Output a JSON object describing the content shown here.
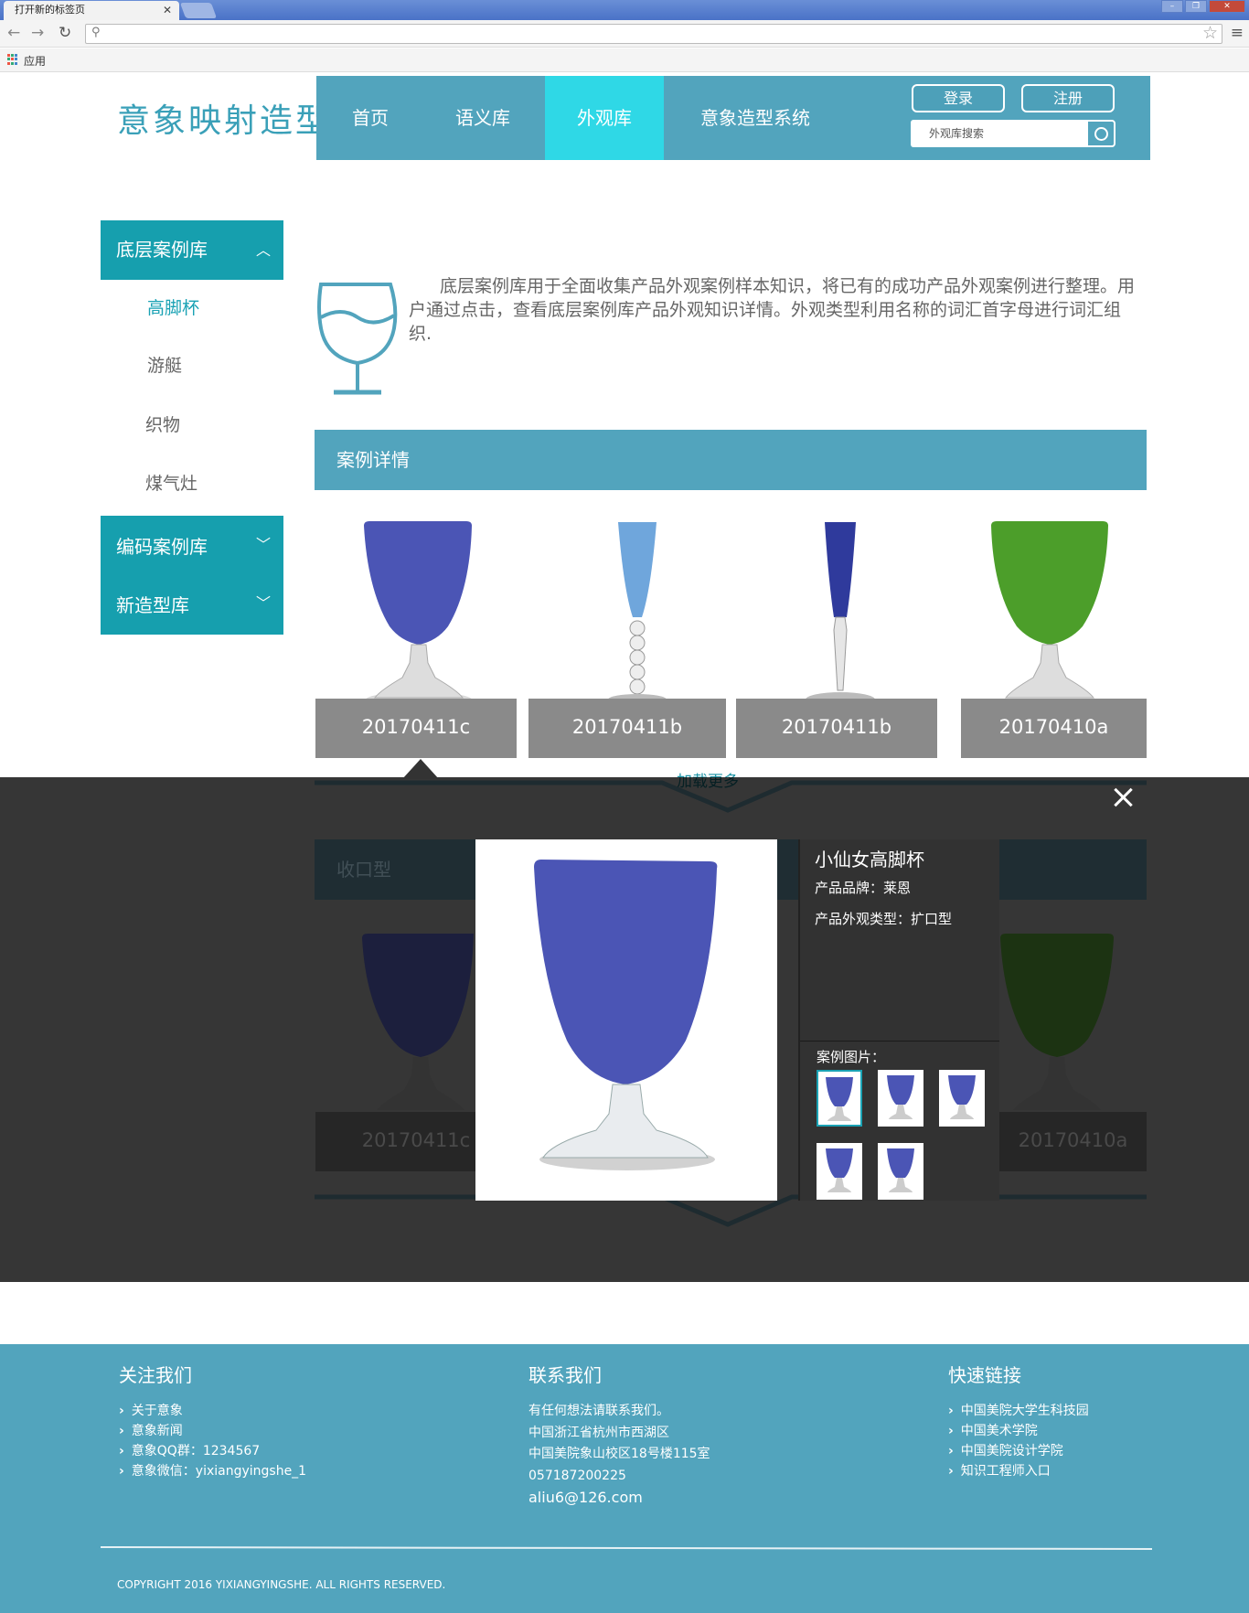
{
  "browser": {
    "tab_title": "打开新的标签页",
    "tab_close": "✕",
    "bookmark_apps": "应用"
  },
  "site": {
    "logo": "意象映射造型",
    "nav": [
      {
        "label": "首页"
      },
      {
        "label": "语义库"
      },
      {
        "label": "外观库"
      },
      {
        "label": "意象造型系统"
      }
    ],
    "login": "登录",
    "register": "注册",
    "search_placeholder": "外观库搜索"
  },
  "sidebar": {
    "group1": "底层案例库",
    "items": [
      "高脚杯",
      "游艇",
      "织物",
      "煤气灶"
    ],
    "group2": "编码案例库",
    "group3": "新造型库"
  },
  "intro": "底层案例库用于全面收集产品外观案例样本知识，将已有的成功产品外观案例进行整理。用户通过点击，查看底层案例库产品外观知识详情。外观类型利用名称的词汇首字母进行词汇组织.",
  "section_title": "案例详情",
  "cards": [
    {
      "label": "20170411c",
      "color": "#4b55b5"
    },
    {
      "label": "20170411b",
      "color": "#6fa6dc"
    },
    {
      "label": "20170411b",
      "color": "#2f3a9c"
    },
    {
      "label": "20170410a",
      "color": "#4c9e2a"
    }
  ],
  "load_more": "加载更多",
  "background_section2": "收口型",
  "bg_cards": [
    {
      "label": "20170411c"
    },
    {
      "label": "20170410a"
    }
  ],
  "modal": {
    "title": "小仙女高脚杯",
    "brand": "产品品牌：莱恩",
    "type": "产品外观类型：扩口型",
    "pics_label": "案例图片：",
    "glass_color": "#4b55b5"
  },
  "footer": {
    "follow_title": "关注我们",
    "follow_items": [
      "关于意象",
      "意象新闻",
      "意象QQ群：1234567",
      "意象微信：yixiangyingshe_1"
    ],
    "contact_title": "联系我们",
    "contact_lines": [
      "有任何想法请联系我们。",
      "中国浙江省杭州市西湖区",
      "中国美院象山校区18号楼115室",
      "057187200225",
      "aliu6@126.com"
    ],
    "links_title": "快速链接",
    "links": [
      "中国美院大学生科技园",
      "中国美术学院",
      "中国美院设计学院",
      "知识工程师入口"
    ],
    "copyright": "COPYRIGHT 2016 YIXIANGYINGSHE. ALL RIGHTS RESERVED."
  }
}
